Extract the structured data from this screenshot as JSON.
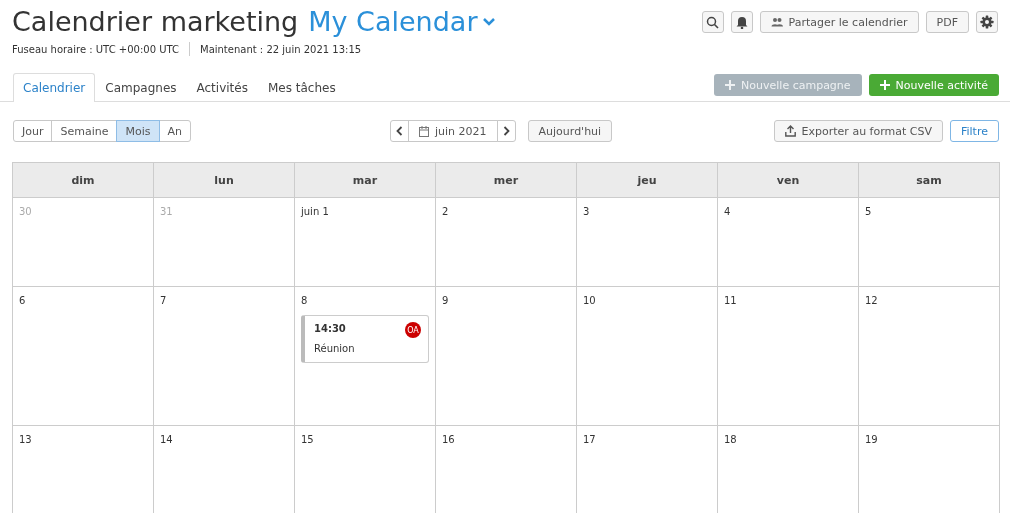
{
  "header": {
    "title": "Calendrier marketing",
    "calendar_name": "My Calendar",
    "timezone": "Fuseau horaire : UTC +00:00 UTC",
    "now": "Maintenant : 22 juin 2021 13:15",
    "share_button": "Partager le calendrier",
    "pdf_button": "PDF"
  },
  "tabs": [
    {
      "label": "Calendrier",
      "selected": true
    },
    {
      "label": "Campagnes",
      "selected": false
    },
    {
      "label": "Activités",
      "selected": false
    },
    {
      "label": "Mes tâches",
      "selected": false
    }
  ],
  "actions": [
    {
      "label": "Nouvelle campagne",
      "disabled": true
    },
    {
      "label": "Nouvelle activité",
      "disabled": false
    }
  ],
  "views": [
    {
      "label": "Jour",
      "selected": false
    },
    {
      "label": "Semaine",
      "selected": false
    },
    {
      "label": "Mois",
      "selected": true
    },
    {
      "label": "An",
      "selected": false
    }
  ],
  "period": "juin 2021",
  "today_button": "Aujourd'hui",
  "export_button": "Exporter au format CSV",
  "filter_button": "Filtre",
  "weekdays": [
    "dim",
    "lun",
    "mar",
    "mer",
    "jeu",
    "ven",
    "sam"
  ],
  "weeks": [
    [
      {
        "label": "30",
        "outside": true
      },
      {
        "label": "31",
        "outside": true
      },
      {
        "label": "juin 1",
        "outside": false
      },
      {
        "label": "2",
        "outside": false
      },
      {
        "label": "3",
        "outside": false
      },
      {
        "label": "4",
        "outside": false
      },
      {
        "label": "5",
        "outside": false
      }
    ],
    [
      {
        "label": "6",
        "outside": false
      },
      {
        "label": "7",
        "outside": false
      },
      {
        "label": "8",
        "outside": false,
        "events": [
          {
            "time": "14:30",
            "title": "Réunion",
            "avatar": "OA",
            "color": "#cc0000"
          }
        ]
      },
      {
        "label": "9",
        "outside": false
      },
      {
        "label": "10",
        "outside": false
      },
      {
        "label": "11",
        "outside": false
      },
      {
        "label": "12",
        "outside": false
      }
    ],
    [
      {
        "label": "13",
        "outside": false
      },
      {
        "label": "14",
        "outside": false
      },
      {
        "label": "15",
        "outside": false
      },
      {
        "label": "16",
        "outside": false
      },
      {
        "label": "17",
        "outside": false
      },
      {
        "label": "18",
        "outside": false
      },
      {
        "label": "19",
        "outside": false
      }
    ]
  ]
}
